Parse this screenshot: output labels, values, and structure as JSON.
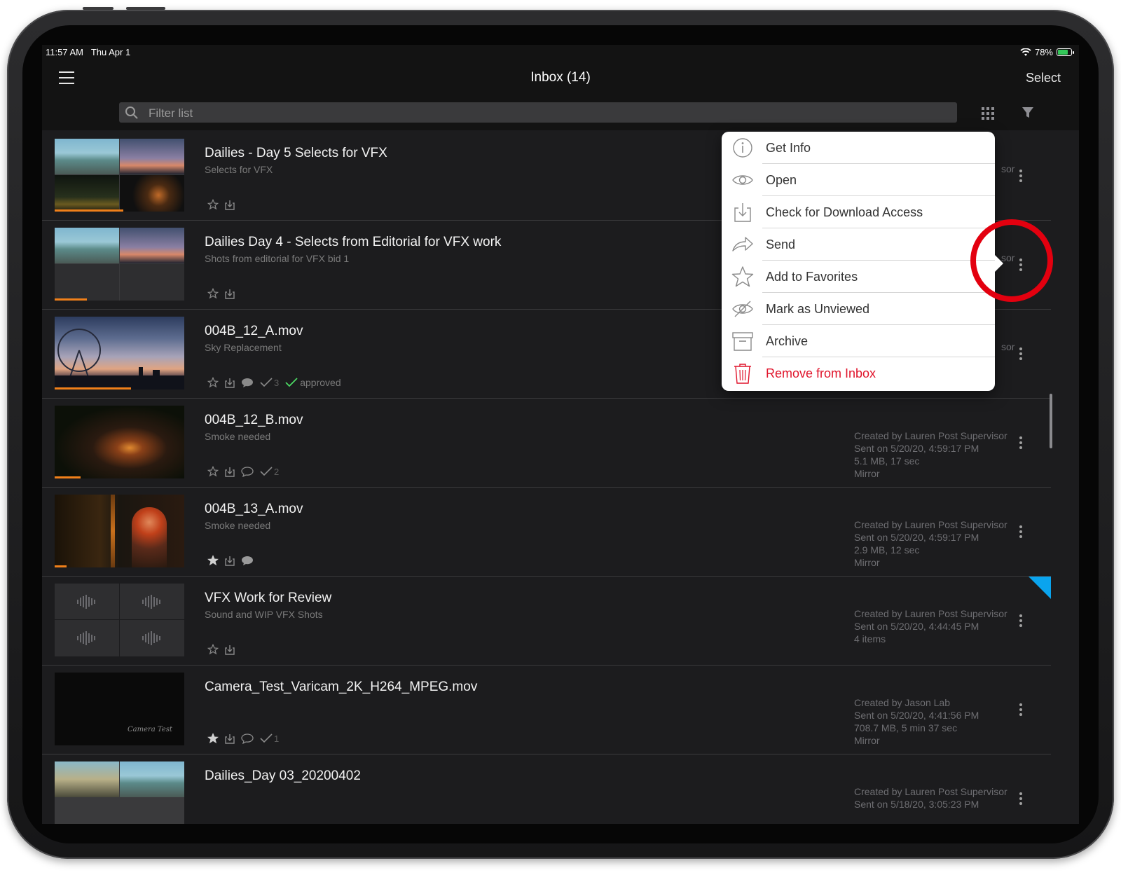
{
  "status": {
    "time": "11:57 AM",
    "date": "Thu Apr 1",
    "battery": "78%",
    "battery_level": 0.78
  },
  "nav": {
    "title": "Inbox (14)",
    "select_label": "Select"
  },
  "search": {
    "placeholder": "Filter list"
  },
  "rows": [
    {
      "title": "Dailies - Day 5 Selects for VFX",
      "subtitle": "Selects for VFX",
      "meta": [
        "sor"
      ],
      "progress": 0.53
    },
    {
      "title": "Dailies Day 4 - Selects from Editorial for VFX work",
      "subtitle": "Shots from editorial for VFX bid 1",
      "meta": [
        "sor"
      ],
      "progress": 0.25
    },
    {
      "title": "004B_12_A.mov",
      "subtitle": "Sky Replacement",
      "approvals": "3",
      "status_label": "approved",
      "meta": [
        "sor"
      ],
      "progress": 0.59
    },
    {
      "title": "004B_12_B.mov",
      "subtitle": "Smoke needed",
      "approvals": "2",
      "meta": [
        "Created by Lauren Post Supervisor",
        "Sent on 5/20/20, 4:59:17 PM",
        "5.1 MB, 17 sec",
        "Mirror"
      ],
      "progress": 0.2
    },
    {
      "title": "004B_13_A.mov",
      "subtitle": "Smoke needed",
      "meta": [
        "Created by Lauren Post Supervisor",
        "Sent on 5/20/20, 4:59:17 PM",
        "2.9 MB, 12 sec",
        "Mirror"
      ],
      "progress": 0.09
    },
    {
      "title": "VFX Work for Review",
      "subtitle": "Sound and WIP VFX Shots",
      "meta": [
        "Created by Lauren Post Supervisor",
        "Sent on 5/20/20, 4:44:45 PM",
        "4 items"
      ]
    },
    {
      "title": "Camera_Test_Varicam_2K_H264_MPEG.mov",
      "subtitle": "",
      "thumb_caption": "Camera Test",
      "approvals": "1",
      "meta": [
        "Created by Jason Lab",
        "Sent on 5/20/20, 4:41:56 PM",
        "708.7 MB, 5 min 37 sec",
        "Mirror"
      ]
    },
    {
      "title": "Dailies_Day 03_20200402",
      "subtitle": "",
      "meta": [
        "Created by Lauren Post Supervisor",
        "Sent on 5/18/20, 3:05:23 PM"
      ]
    }
  ],
  "menu": {
    "items": [
      {
        "label": "Get Info",
        "icon": "info-icon"
      },
      {
        "label": "Open",
        "icon": "eye-icon"
      },
      {
        "label": "Check for Download Access",
        "icon": "download-icon"
      },
      {
        "label": "Send",
        "icon": "share-arrow-icon"
      },
      {
        "label": "Add to Favorites",
        "icon": "star-icon"
      },
      {
        "label": "Mark as Unviewed",
        "icon": "eye-slash-icon"
      },
      {
        "label": "Archive",
        "icon": "archive-box-icon"
      },
      {
        "label": "Remove from Inbox",
        "icon": "trash-icon",
        "destructive": true
      }
    ]
  },
  "colors": {
    "accent_orange": "#f0801a",
    "destructive_red": "#e0142b",
    "highlight_circle": "#e3000f",
    "flag_blue": "#0aa4ee",
    "background": "#1c1c1e"
  }
}
